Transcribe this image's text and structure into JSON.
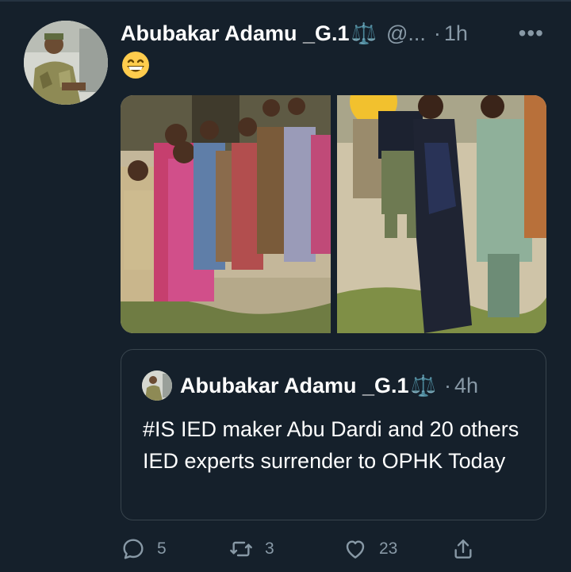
{
  "tweet": {
    "author_name": "Abubakar Adamu _G.1",
    "author_badge": "⚖️",
    "handle": "@...",
    "separator": "·",
    "time": "1h",
    "more": "•••",
    "body_emoji": "😁"
  },
  "quoted": {
    "author_name": "Abubakar Adamu _G.1",
    "author_badge": "⚖️",
    "separator": "·",
    "time": "4h",
    "text": "#IS IED maker Abu Dardi and 20 others IED experts surrender to OPHK  Today"
  },
  "actions": {
    "reply_count": "5",
    "retweet_count": "3",
    "like_count": "23"
  },
  "colors": {
    "background": "#15202b",
    "secondary_text": "#8899a6",
    "border": "#38444d"
  }
}
